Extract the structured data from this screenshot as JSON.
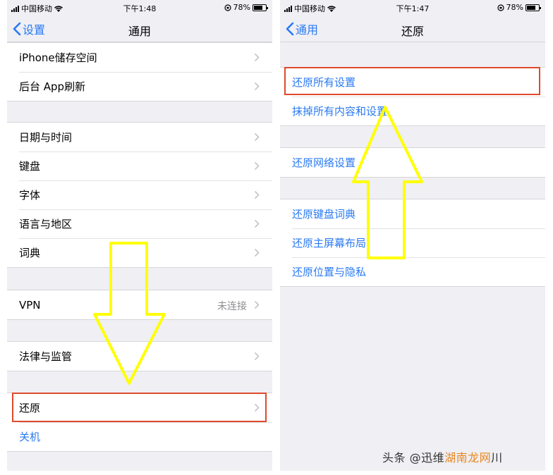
{
  "left": {
    "status": {
      "carrier": "中国移动",
      "time": "下午1:48",
      "battery": "78%",
      "battery_level": 0.78
    },
    "nav": {
      "back": "设置",
      "title": "通用"
    },
    "groups": [
      {
        "items": [
          "iPhone储存空间",
          "后台 App刷新"
        ]
      },
      {
        "items": [
          "日期与时间",
          "键盘",
          "字体",
          "语言与地区",
          "词典"
        ]
      },
      {
        "items": [
          "VPN"
        ],
        "detail": "未连接"
      },
      {
        "items": [
          "法律与监管"
        ]
      },
      {
        "items": [
          "还原",
          "关机"
        ]
      }
    ]
  },
  "right": {
    "status": {
      "carrier": "中国移动",
      "time": "下午1:47",
      "battery": "78%",
      "battery_level": 0.78
    },
    "nav": {
      "back": "通用",
      "title": "还原"
    },
    "groups": [
      {
        "items": [
          "还原所有设置",
          "抹掉所有内容和设置"
        ]
      },
      {
        "items": [
          "还原网络设置"
        ]
      },
      {
        "items": [
          "还原键盘词典",
          "还原主屏幕布局",
          "还原位置与隐私"
        ]
      }
    ]
  },
  "watermark": {
    "prefix": "头条 @迅维",
    "brand": "湖南龙网",
    "suffix": "川"
  },
  "colors": {
    "link_blue": "#2a7af3",
    "highlight_red": "#e04a2c",
    "arrow_yellow": "#ffff00",
    "background_gray": "#efeff4"
  },
  "icons": [
    "chevron-left-icon",
    "chevron-right-icon",
    "wifi-icon",
    "signal-icon",
    "orientation-lock-icon",
    "battery-icon"
  ]
}
